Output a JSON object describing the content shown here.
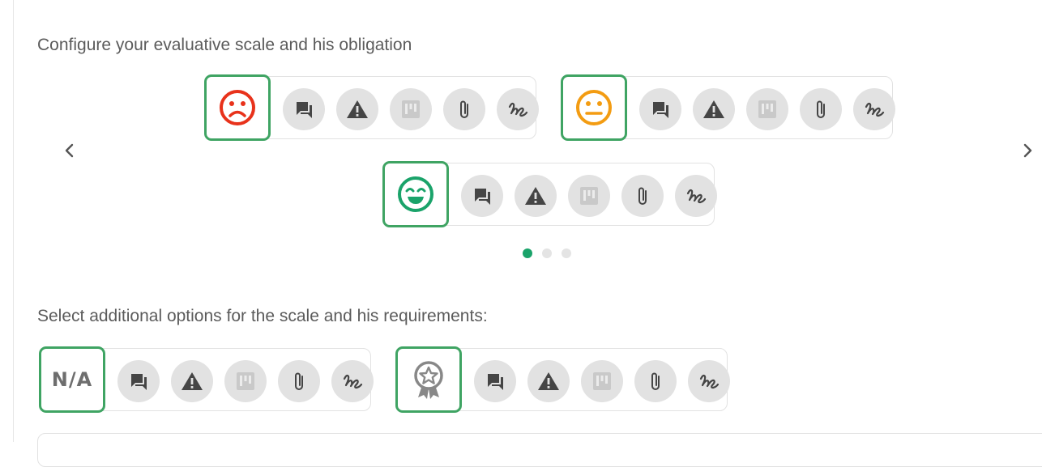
{
  "headings": {
    "scale": "Configure your evaluative scale and his obligation",
    "additional": "Select additional options for the scale and his requirements:"
  },
  "colors": {
    "selected_border": "#3fa463",
    "sad": "#e8321b",
    "neutral": "#f39c12",
    "happy": "#1aa36a",
    "option_bg": "#e2e2e2",
    "option_icon": "#454545",
    "dot_active": "#1aa36a"
  },
  "scale_items": [
    {
      "name": "sad",
      "icon": "sad-face-icon"
    },
    {
      "name": "neutral",
      "icon": "neutral-face-icon"
    },
    {
      "name": "happy",
      "icon": "happy-face-icon"
    }
  ],
  "extra_items": [
    {
      "name": "not-applicable",
      "label": "N/A"
    },
    {
      "name": "excellent",
      "icon": "award-star-icon"
    }
  ],
  "options": [
    "comment-icon",
    "warning-icon",
    "kanban-icon",
    "paperclip-icon",
    "signature-icon"
  ],
  "carousel": {
    "pages": 3,
    "active": 0
  }
}
